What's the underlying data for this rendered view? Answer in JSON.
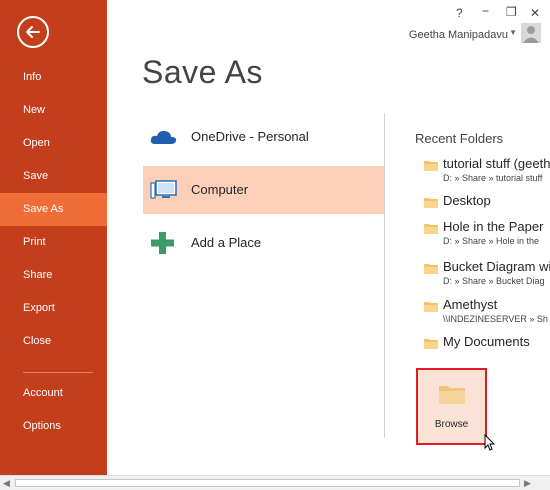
{
  "colors": {
    "sidebar": "#c43e1c",
    "sidebar_active": "#f06d38",
    "selected_location": "#fbcfb8",
    "highlight_box": "#e01b24"
  },
  "window": {
    "help": "?",
    "restore": "❐",
    "minimize": "−",
    "close": "✕"
  },
  "user": {
    "name": "Geetha Manipadavu"
  },
  "sidebar": {
    "back_icon": "back-arrow-icon",
    "items": [
      {
        "label": "Info"
      },
      {
        "label": "New"
      },
      {
        "label": "Open"
      },
      {
        "label": "Save"
      },
      {
        "label": "Save As"
      },
      {
        "label": "Print"
      },
      {
        "label": "Share"
      },
      {
        "label": "Export"
      },
      {
        "label": "Close"
      },
      {
        "label": "Account"
      },
      {
        "label": "Options"
      }
    ]
  },
  "main": {
    "title": "Save As"
  },
  "locations": [
    {
      "label": "OneDrive - Personal",
      "icon": "cloud-icon"
    },
    {
      "label": "Computer",
      "icon": "computer-icon"
    },
    {
      "label": "Add a Place",
      "icon": "plus-icon"
    }
  ],
  "recent": {
    "title": "Recent Folders",
    "folders": [
      {
        "name": "tutorial stuff (geeth",
        "path": "D: » Share » tutorial stuff"
      },
      {
        "name": "Desktop",
        "path": ""
      },
      {
        "name": "Hole in the Paper",
        "path": "D: » Share » Hole in the"
      },
      {
        "name": "Bucket Diagram wi",
        "path": "D: » Share » Bucket Diag"
      },
      {
        "name": "Amethyst",
        "path": "\\\\INDEZINESERVER » Sh"
      },
      {
        "name": "My Documents",
        "path": ""
      }
    ]
  },
  "browse": {
    "label": "Browse",
    "icon": "folder-icon"
  }
}
